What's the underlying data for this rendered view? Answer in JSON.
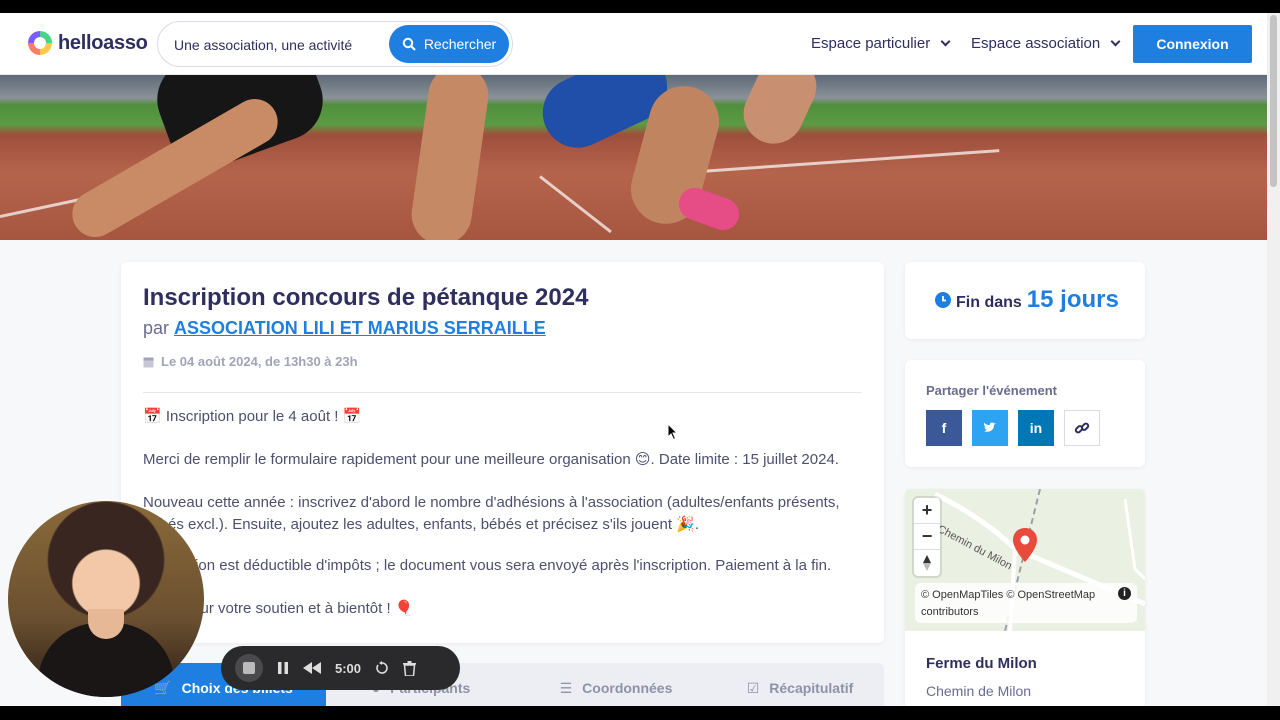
{
  "header": {
    "logo_text": "helloasso",
    "search_placeholder": "Une association, une activité",
    "search_button": "Rechercher",
    "nav": [
      "Espace particulier",
      "Espace association"
    ],
    "login": "Connexion"
  },
  "event": {
    "title": "Inscription concours de pétanque 2024",
    "by_prefix": "par",
    "organizer": "ASSOCIATION LILI ET MARIUS SERRAILLE",
    "date": "Le 04 août 2024, de 13h30 à 23h",
    "paragraphs": [
      "📅 Inscription pour le 4 août ! 📅",
      "Merci de remplir le formulaire rapidement pour une meilleure organisation 😊. Date limite : 15 juillet 2024.",
      "Nouveau cette année : inscrivez d'abord le nombre d'adhésions à l'association (adultes/enfants présents, bébés excl.). Ensuite, ajoutez les adultes, enfants, bébés et précisez s'ils jouent 🎉.",
      "L'adhésion est déductible d'impôts ; le document vous sera envoyé après l'inscription. Paiement à la fin.",
      "Merci pour votre soutien et à bientôt ! 🎈"
    ]
  },
  "steps": [
    "Choix des billets",
    "Participants",
    "Coordonnées",
    "Récapitulatif"
  ],
  "sidebar": {
    "end_prefix": "Fin dans",
    "end_value": "15 jours",
    "share_title": "Partager l'événement",
    "share_icons": [
      "facebook-icon",
      "twitter-icon",
      "linkedin-icon",
      "link-icon"
    ],
    "map_road_label": "Chemin du Milon",
    "map_attribution": "© OpenMapTiles © OpenStreetMap contributors",
    "place_name": "Ferme du Milon",
    "place_address": "Chemin de Milon"
  },
  "recorder": {
    "time": "5:00"
  },
  "colors": {
    "primary": "#1f7fe1",
    "facebook": "#3b5998",
    "twitter": "#2ea3f2",
    "linkedin": "#0077b5",
    "map_marker": "#e84b3c"
  }
}
